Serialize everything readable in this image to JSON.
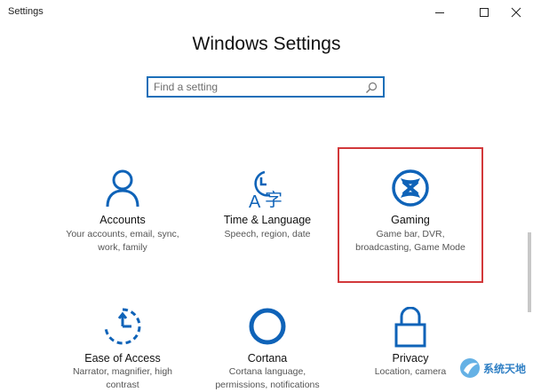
{
  "window": {
    "title": "Settings",
    "controls": [
      "minimize-icon",
      "maximize-icon",
      "close-icon"
    ]
  },
  "header": {
    "title": "Windows Settings"
  },
  "search": {
    "placeholder": "Find a setting",
    "value": ""
  },
  "tiles": [
    {
      "name": "Accounts",
      "desc": [
        "Your accounts, email, sync,",
        "work, family"
      ],
      "icon": "person-icon"
    },
    {
      "name": "Time & Language",
      "desc": [
        "Speech, region, date"
      ],
      "icon": "time-language-icon"
    },
    {
      "name": "Gaming",
      "desc": [
        "Game bar, DVR,",
        "broadcasting, Game Mode"
      ],
      "icon": "xbox-icon",
      "highlighted": true
    },
    {
      "name": "Ease of Access",
      "desc": [
        "Narrator, magnifier, high",
        "contrast"
      ],
      "icon": "ease-of-access-icon"
    },
    {
      "name": "Cortana",
      "desc": [
        "Cortana language,",
        "permissions, notifications"
      ],
      "icon": "cortana-icon"
    },
    {
      "name": "Privacy",
      "desc": [
        "Location, camera"
      ],
      "icon": "lock-icon"
    }
  ],
  "watermark": {
    "text": "系统天地"
  },
  "colors": {
    "accent": "#0f63b8",
    "highlight": "#d2383a",
    "search_border": "#1c6fb8"
  }
}
